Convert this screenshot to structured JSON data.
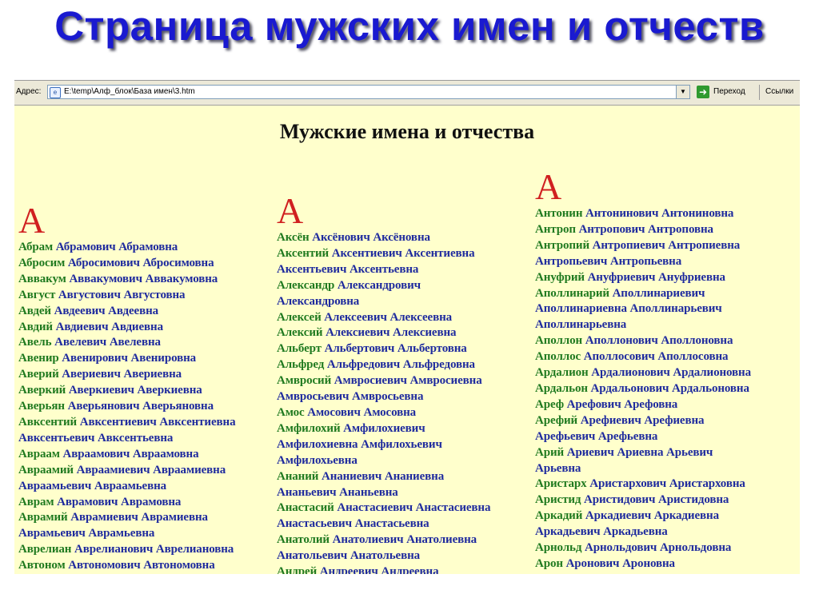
{
  "slide_title": "Страница мужских имен и отчеств",
  "browser": {
    "address_label": "Адрес:",
    "address_value": "E:\\temp\\Алф_блок\\База имен\\3.htm",
    "go_label": "Переход",
    "links_label": "Ссылки"
  },
  "page": {
    "heading": "Мужские имена и отчества",
    "columns": [
      {
        "letter": "А",
        "entries": [
          {
            "name": "Абрам",
            "rest": " Абрамович Абрамовна"
          },
          {
            "name": "Абросим",
            "rest": " Абросимович Абросимовна"
          },
          {
            "name": "Аввакум",
            "rest": " Аввакумович Аввакумовна"
          },
          {
            "name": "Август",
            "rest": " Августович Августовна"
          },
          {
            "name": "Авдей",
            "rest": " Авдеевич Авдеевна"
          },
          {
            "name": "Авдий",
            "rest": " Авдиевич Авдиевна"
          },
          {
            "name": "Авель",
            "rest": " Авелевич Авелевна"
          },
          {
            "name": "Авенир",
            "rest": " Авенирович Авенировна"
          },
          {
            "name": "Аверий",
            "rest": " Авериевич Авериевна"
          },
          {
            "name": "Аверкий",
            "rest": " Аверкиевич Аверкиевна"
          },
          {
            "name": "Аверьян",
            "rest": " Аверьянович Аверьяновна"
          },
          {
            "name": "Авксентий",
            "rest": " Авксентиевич Авксентиевна"
          },
          {
            "name": "",
            "rest": "Авксентьевич Авксентьевна"
          },
          {
            "name": "Авраам",
            "rest": " Авраамович Авраамовна"
          },
          {
            "name": "Авраамий",
            "rest": " Авраамиевич Авраамиевна"
          },
          {
            "name": "",
            "rest": "Авраамьевич Авраамьевна"
          },
          {
            "name": "Аврам",
            "rest": " Аврамович Аврамовна"
          },
          {
            "name": "Аврамий",
            "rest": " Аврамиевич Аврамиевна"
          },
          {
            "name": "",
            "rest": "Аврамьевич Аврамьевна"
          },
          {
            "name": "Аврелиан",
            "rest": " Аврелианович Аврелиановна"
          },
          {
            "name": "Автоном",
            "rest": " Автономович Автономовна"
          }
        ]
      },
      {
        "letter": "А",
        "entries": [
          {
            "name": "Аксён",
            "rest": " Аксёнович Аксёновна"
          },
          {
            "name": "Аксентий",
            "rest": " Аксентиевич Аксентиевна"
          },
          {
            "name": "",
            "rest": "Аксентьевич Аксентьевна"
          },
          {
            "name": "Александр",
            "rest": " Александрович"
          },
          {
            "name": "",
            "rest": "Александровна"
          },
          {
            "name": "Алексей",
            "rest": " Алексеевич Алексеевна"
          },
          {
            "name": "Алексий",
            "rest": " Алексиевич Алексиевна"
          },
          {
            "name": "Альберт",
            "rest": " Альбертович Альбертовна"
          },
          {
            "name": "Альфред",
            "rest": " Альфредович Альфредовна"
          },
          {
            "name": "Амвросий",
            "rest": " Амвросиевич Амвросиевна"
          },
          {
            "name": "",
            "rest": "Амвросьевич Амвросьевна"
          },
          {
            "name": "Амос",
            "rest": " Амосович Амосовна"
          },
          {
            "name": "Амфилохий",
            "rest": " Амфилохиевич"
          },
          {
            "name": "",
            "rest": "Амфилохиевна Амфилохьевич"
          },
          {
            "name": "",
            "rest": "Амфилохьевна"
          },
          {
            "name": "Ананий",
            "rest": " Ананиевич Ананиевна"
          },
          {
            "name": "",
            "rest": "Ананьевич Ананьевна"
          },
          {
            "name": "Анастасий",
            "rest": " Анастасиевич Анастасиевна"
          },
          {
            "name": "",
            "rest": "Анастасьевич Анастасьевна"
          },
          {
            "name": "Анатолий",
            "rest": " Анатолиевич Анатолиевна"
          },
          {
            "name": "",
            "rest": "Анатольевич Анатольевна"
          },
          {
            "name": "Андрей",
            "rest": " Андреевич Андреевна"
          }
        ]
      },
      {
        "letter": "А",
        "entries": [
          {
            "name": "Антонин",
            "rest": " Антонинович Антониновна"
          },
          {
            "name": "Антроп",
            "rest": " Антропович Антроповна"
          },
          {
            "name": "Антропий",
            "rest": " Антропиевич Антропиевна"
          },
          {
            "name": "",
            "rest": "Антропьевич Антропьевна"
          },
          {
            "name": "Ануфрий",
            "rest": " Ануфриевич Ануфриевна"
          },
          {
            "name": "Аполлинарий",
            "rest": " Аполлинариевич"
          },
          {
            "name": "",
            "rest": "Аполлинариевна Аполлинарьевич"
          },
          {
            "name": "",
            "rest": "Аполлинарьевна"
          },
          {
            "name": "Аполлон",
            "rest": " Аполлонович Аполлоновна"
          },
          {
            "name": "Аполлос",
            "rest": " Аполлосович Аполлосовна"
          },
          {
            "name": "Ардалион",
            "rest": " Ардалионович Ардалионовна"
          },
          {
            "name": "Ардальон",
            "rest": " Ардальонович Ардальоновна"
          },
          {
            "name": "Ареф",
            "rest": " Арефович Арефовна"
          },
          {
            "name": "Арефий",
            "rest": " Арефиевич Арефиевна"
          },
          {
            "name": "",
            "rest": "Арефьевич Арефьевна"
          },
          {
            "name": "Арий",
            "rest": " Ариевич Ариевна Арьевич"
          },
          {
            "name": "",
            "rest": "Арьевна"
          },
          {
            "name": "Аристарх",
            "rest": " Аристархович Аристарховна"
          },
          {
            "name": "Аристид",
            "rest": " Аристидович Аристидовна"
          },
          {
            "name": "Аркадий",
            "rest": " Аркадиевич Аркадиевна"
          },
          {
            "name": "",
            "rest": "Аркадьевич Аркадьевна"
          },
          {
            "name": "Арнольд",
            "rest": " Арнольдович Арнольдовна"
          },
          {
            "name": "Арон",
            "rest": " Аронович Ароновна"
          }
        ]
      }
    ]
  }
}
